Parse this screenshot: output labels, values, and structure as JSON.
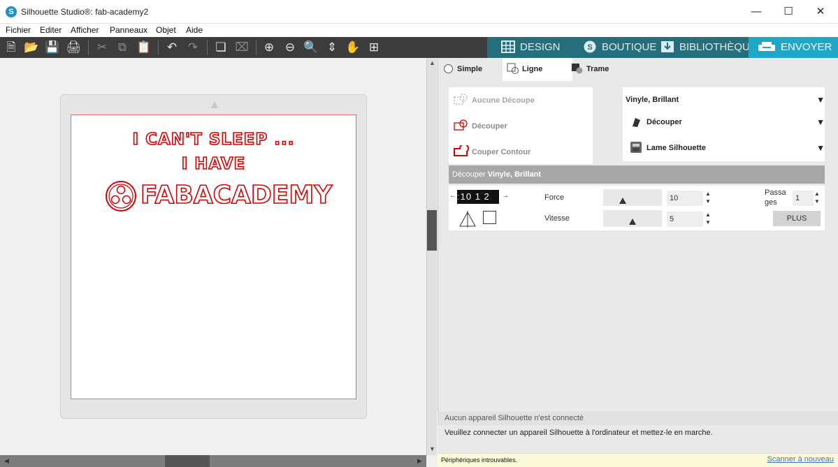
{
  "window": {
    "title": "Silhouette Studio®: fab-academy2",
    "app_icon": "S",
    "minimize": "—",
    "maximize": "☐",
    "close": "✕"
  },
  "menu": [
    "Fichier",
    "Editer",
    "Afficher",
    "Panneaux",
    "Objet",
    "Aide"
  ],
  "toolbar": {
    "icons": [
      "new-icon",
      "open-icon",
      "save-icon",
      "print-icon",
      "cut-icon",
      "copy-icon",
      "paste-icon",
      "undo-icon",
      "redo-icon",
      "group-icon",
      "ungroup-icon",
      "zoom-in-icon",
      "zoom-out-icon",
      "zoom-select-icon",
      "move-down-icon",
      "pan-hand-icon",
      "fit-page-icon"
    ]
  },
  "nav": {
    "design": "DESIGN",
    "boutique": "BOUTIQUE",
    "bibliotheque": "BIBLIOTHÈQUE",
    "envoyer": "ENVOYER",
    "active_color": "#1ea7c6",
    "base_color": "#276e7d"
  },
  "design": {
    "line1": "I CAN'T SLEEP ...",
    "line2": "I HAVE",
    "line3": "FABACADEMY",
    "cut_color": "#d60000"
  },
  "panel": {
    "tabs": [
      "Simple",
      "Ligne",
      "Trame"
    ],
    "cut_options": [
      "Aucune Découpe",
      "Découper",
      "Couper Contour"
    ],
    "material": "Vinyle, Brillant",
    "action": "Découper",
    "tool": "Lame Silhouette",
    "header_prefix": "Découper",
    "header_material": "Vinyle, Brillant",
    "blade_values": "10 1 2",
    "force_label": "Force",
    "force_value": "10",
    "force_level": 0.33,
    "vitesse_label": "Vitesse",
    "vitesse_value": "5",
    "vitesse_level": 0.5,
    "passages_label": "Passa ges",
    "passages_value": "1",
    "plus": "PLUS"
  },
  "status": {
    "device": "Aucun appareil Silhouette n'est connecté",
    "instruction": "Veuillez connecter un appareil Silhouette à l'ordinateur et mettez-le en marche.",
    "footer_msg": "Périphériques introuvables.",
    "rescan": "Scanner à nouveau"
  }
}
